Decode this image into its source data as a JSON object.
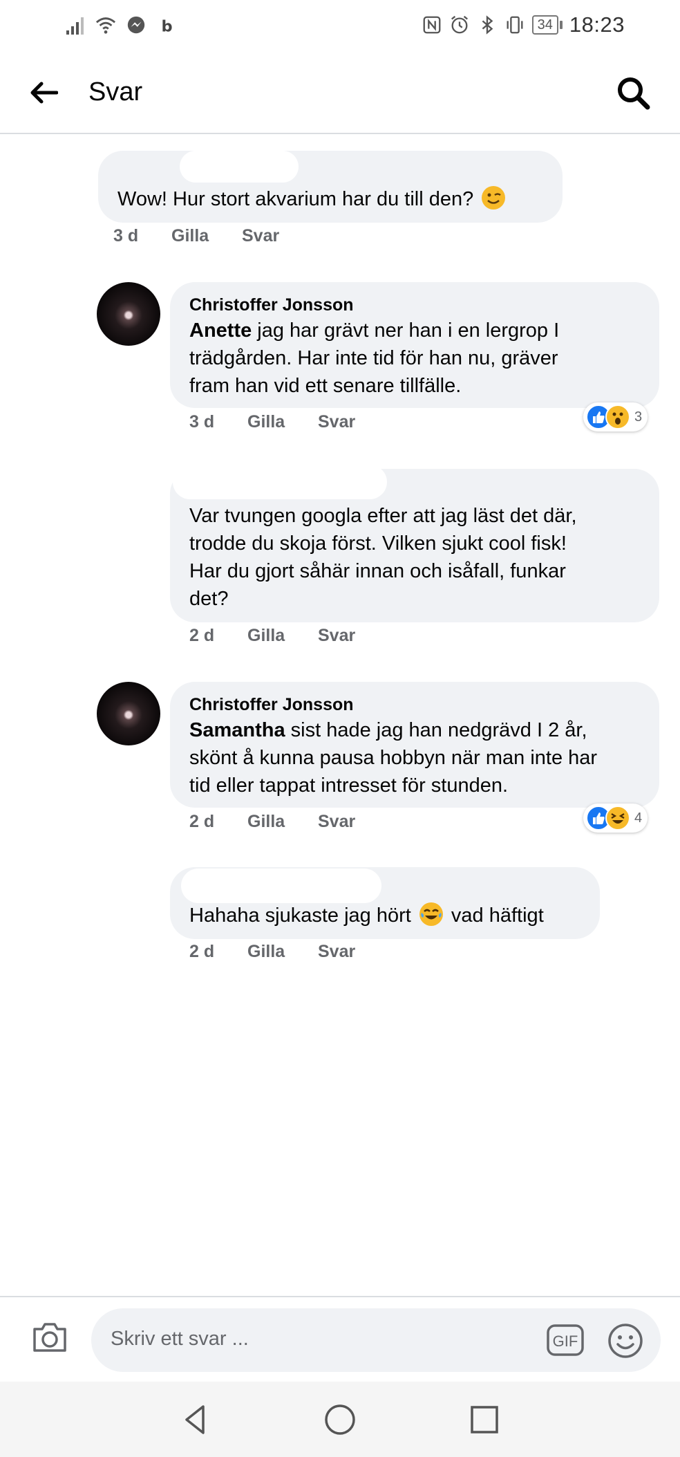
{
  "status_bar": {
    "time": "18:23",
    "battery": "34",
    "left_icons": [
      "signal-icon",
      "wifi-icon",
      "messenger-icon",
      "b-icon"
    ],
    "right_icons": [
      "nfc-icon",
      "alarm-icon",
      "bluetooth-icon",
      "vibrate-icon"
    ]
  },
  "header": {
    "title": "Svar"
  },
  "comments": [
    {
      "author": "",
      "text": "Wow! Hur stort akvarium har du till den?",
      "emoji": "winking-face",
      "time": "3 d",
      "like": "Gilla",
      "reply": "Svar"
    },
    {
      "author": "Christoffer Jonsson",
      "mention": "Anette",
      "text_lines": [
        " jag har grävt ner han i en lergrop I",
        "trädgården. Har inte tid för han nu, gräver",
        "fram han vid ett senare tillfälle."
      ],
      "time": "3 d",
      "like": "Gilla",
      "reply": "Svar",
      "reactions": {
        "types": [
          "like",
          "wow"
        ],
        "count": "3"
      }
    },
    {
      "author": "",
      "text_lines": [
        "Var tvungen googla efter att jag läst det där,",
        "trodde du skoja först. Vilken sjukt cool fisk!",
        "Har du gjort såhär innan och isåfall, funkar",
        "det?"
      ],
      "time": "2 d",
      "like": "Gilla",
      "reply": "Svar"
    },
    {
      "author": "Christoffer Jonsson",
      "mention": "Samantha",
      "text_lines": [
        " sist hade jag han nedgrävd I 2 år,",
        "skönt å kunna pausa hobbyn när man inte har",
        "tid eller tappat intresset för stunden."
      ],
      "time": "2 d",
      "like": "Gilla",
      "reply": "Svar",
      "reactions": {
        "types": [
          "like",
          "haha"
        ],
        "count": "4"
      }
    },
    {
      "author": "",
      "text_before": "Hahaha sjukaste jag hört ",
      "emoji": "tears-of-joy",
      "text_after": " vad häftigt",
      "time": "2 d",
      "like": "Gilla",
      "reply": "Svar"
    }
  ],
  "composer": {
    "placeholder": "Skriv ett svar ...",
    "gif_label": "GIF"
  },
  "colors": {
    "bubble": "#f0f2f5",
    "meta_text": "#65676b",
    "like_blue": "#1877f2",
    "emoji_yellow": "#f7b928"
  }
}
